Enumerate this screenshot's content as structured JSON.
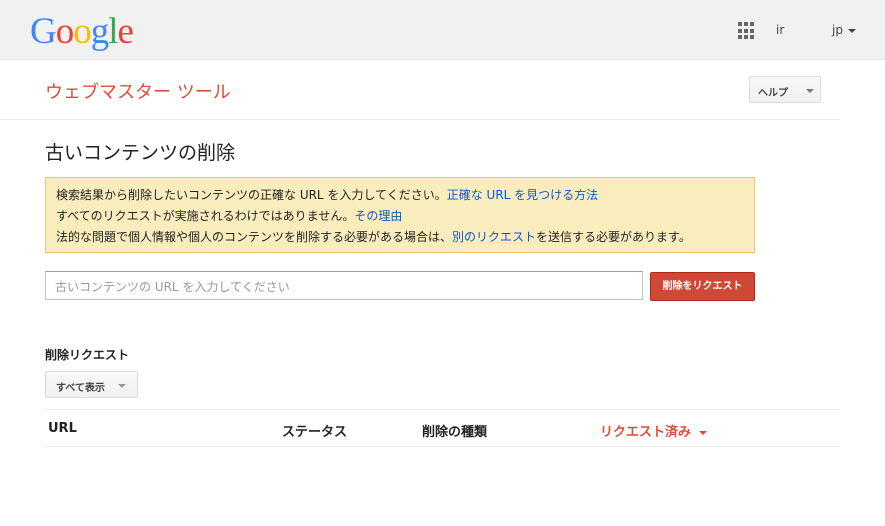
{
  "header": {
    "logo_letters": [
      {
        "char": "G",
        "color": "#4285f4"
      },
      {
        "char": "o",
        "color": "#ea4335"
      },
      {
        "char": "o",
        "color": "#fbbc05"
      },
      {
        "char": "g",
        "color": "#4285f4"
      },
      {
        "char": "l",
        "color": "#34a853"
      },
      {
        "char": "e",
        "color": "#ea4335"
      }
    ],
    "apps_icon": "apps-grid-icon",
    "user_id": "ir",
    "language": "jp"
  },
  "app": {
    "title": "ウェブマスター ツール",
    "help_label": "ヘルプ"
  },
  "page": {
    "title": "古いコンテンツの削除"
  },
  "notice": {
    "line1_text": "検索結果から削除したいコンテンツの正確な URL を入力してください。",
    "line1_link": "正確な URL を見つける方法",
    "line2_text": "すべてのリクエストが実施されるわけではありません。",
    "line2_link": "その理由",
    "line3_text_before": "法的な問題で個人情報や個人のコンテンツを削除する必要がある場合は、",
    "line3_link": "別のリクエスト",
    "line3_text_after": "を送信する必要があります。"
  },
  "form": {
    "url_placeholder": "古いコンテンツの URL を入力してください",
    "url_value": "",
    "submit_label": "削除をリクエスト"
  },
  "requests": {
    "section_title": "削除リクエスト",
    "filter_label": "すべて表示",
    "columns": [
      "URL",
      "ステータス",
      "削除の種類",
      "リクエスト済み"
    ],
    "sorted_column": "リクエスト済み",
    "rows": []
  },
  "colors": {
    "accent_red": "#dd4b39",
    "button_red": "#d14836",
    "link_blue": "#1155cc",
    "notice_bg": "#f9edbe",
    "notice_border": "#f0c36d"
  }
}
